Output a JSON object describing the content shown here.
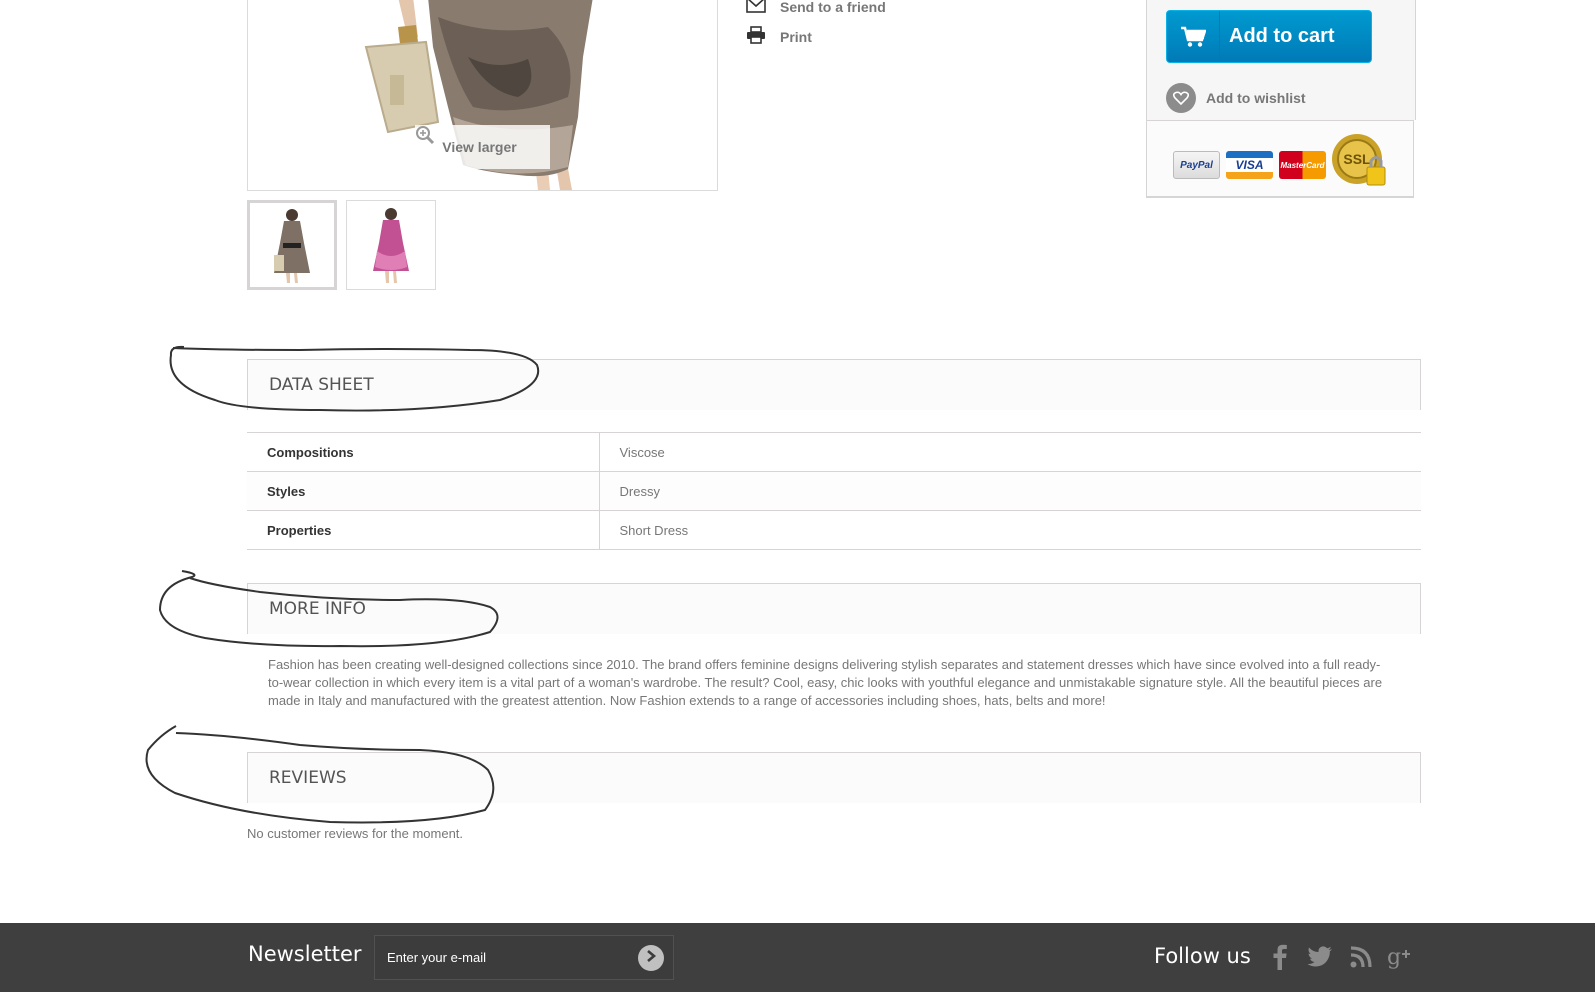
{
  "product": {
    "view_larger": "View larger",
    "thumbnails": [
      "thumbnail-1",
      "thumbnail-2"
    ]
  },
  "actions": {
    "send_to_friend": "Send to a friend",
    "print": "Print"
  },
  "buy": {
    "add_to_cart": "Add to cart",
    "add_to_wishlist": "Add to wishlist",
    "payments": [
      "PayPal",
      "VISA",
      "MasterCard",
      "SSL"
    ]
  },
  "sections": {
    "data_sheet": "DATA SHEET",
    "more_info": "MORE INFO",
    "reviews": "REVIEWS"
  },
  "data_sheet": [
    {
      "key": "Compositions",
      "value": "Viscose"
    },
    {
      "key": "Styles",
      "value": "Dressy"
    },
    {
      "key": "Properties",
      "value": "Short Dress"
    }
  ],
  "more_info_text": "Fashion has been creating well-designed collections since 2010. The brand offers feminine designs delivering stylish separates and statement dresses which have since evolved into a full ready-to-wear collection in which every item is a vital part of a woman's wardrobe. The result? Cool, easy, chic looks with youthful elegance and unmistakable signature style. All the beautiful pieces are made in Italy and manufactured with the greatest attention. Now Fashion extends to a range of accessories including shoes, hats, belts and more!",
  "reviews_empty": "No customer reviews for the moment.",
  "footer": {
    "newsletter_title": "Newsletter",
    "newsletter_placeholder": "Enter your e-mail",
    "follow_us": "Follow us",
    "social": [
      "facebook-icon",
      "twitter-icon",
      "rss-icon",
      "google-plus-icon"
    ]
  },
  "colors": {
    "cart_button": "#0089c7",
    "footer_bg": "#3f3f3f",
    "border": "#d6d4d4"
  }
}
